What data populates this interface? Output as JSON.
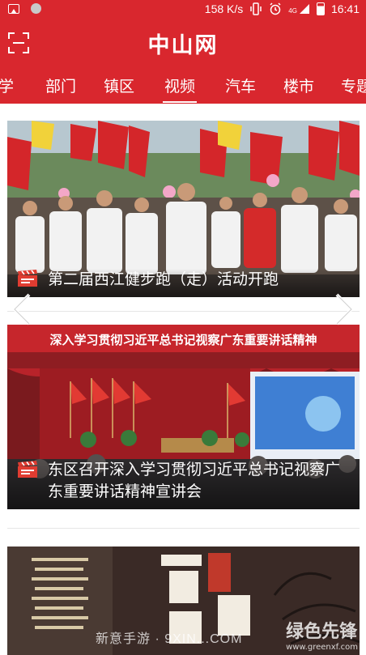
{
  "status_bar": {
    "network_speed": "158 K/s",
    "signal": "4G",
    "time": "16:41"
  },
  "header": {
    "title": "中山网"
  },
  "tabs": [
    {
      "label": "学"
    },
    {
      "label": "部门"
    },
    {
      "label": "镇区"
    },
    {
      "label": "视频"
    },
    {
      "label": "汽车"
    },
    {
      "label": "楼市"
    },
    {
      "label": "专题"
    }
  ],
  "active_tab": "视频",
  "videos": [
    {
      "title": "第二届西江健步跑（走）活动开跑"
    },
    {
      "title": "东区召开深入学习贯彻习近平总书记视察广东重要讲话精神宣讲会"
    },
    {
      "title": ""
    }
  ],
  "image_text": {
    "banner": "深入学习贯彻习近平总书记视察广东重要讲话精神"
  },
  "watermarks": {
    "left": "新意手游 · 9XIN...COM",
    "right": "绿色先锋",
    "right_url": "www.greenxf.com"
  },
  "colors": {
    "brand_red": "#d9272e"
  }
}
